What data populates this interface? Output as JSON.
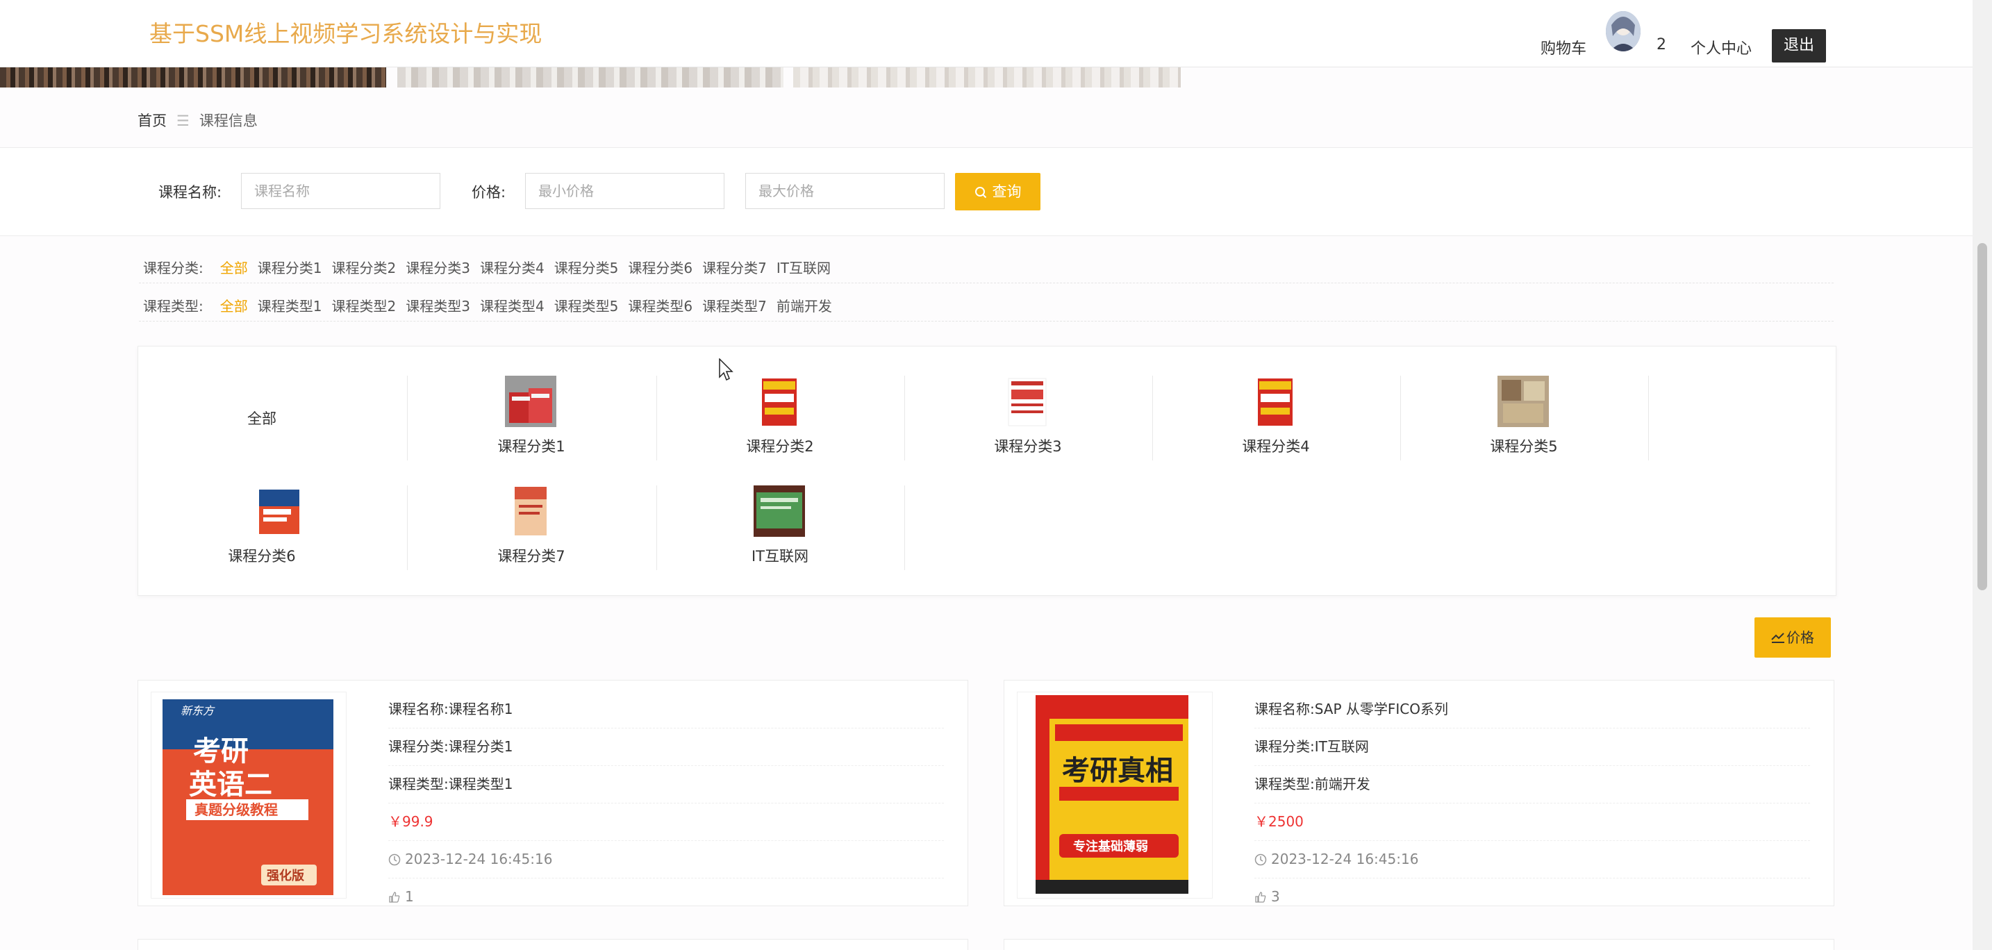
{
  "header": {
    "site_title": "基于SSM线上视频学习系统设计与实现",
    "cart_label": "购物车",
    "avatar_count": "2",
    "user_center_label": "个人中心",
    "logout_label": "退出"
  },
  "breadcrumb": {
    "home": "首页",
    "separator": "☰",
    "current": "课程信息"
  },
  "search": {
    "name_label": "课程名称:",
    "name_placeholder": "课程名称",
    "price_label": "价格:",
    "min_price_placeholder": "最小价格",
    "max_price_placeholder": "最大价格",
    "query_label": "查询"
  },
  "filters": {
    "category": {
      "label": "课程分类:",
      "options": [
        "全部",
        "课程分类1",
        "课程分类2",
        "课程分类3",
        "课程分类4",
        "课程分类5",
        "课程分类6",
        "课程分类7",
        "IT互联网"
      ],
      "active": "全部"
    },
    "type": {
      "label": "课程类型:",
      "options": [
        "全部",
        "课程类型1",
        "课程类型2",
        "课程类型3",
        "课程类型4",
        "课程类型5",
        "课程类型6",
        "课程类型7",
        "前端开发"
      ],
      "active": "全部"
    }
  },
  "category_panel": {
    "items": [
      {
        "name": "全部",
        "image": false
      },
      {
        "name": "课程分类1",
        "image": true
      },
      {
        "name": "课程分类2",
        "image": true
      },
      {
        "name": "课程分类3",
        "image": true
      },
      {
        "name": "课程分类4",
        "image": true
      },
      {
        "name": "课程分类5",
        "image": true
      },
      {
        "name": "课程分类6",
        "image": true
      },
      {
        "name": "课程分类7",
        "image": true
      },
      {
        "name": "IT互联网",
        "image": true
      }
    ]
  },
  "sort": {
    "price_label": "价格"
  },
  "courses": [
    {
      "name": "课程名称:课程名称1",
      "category": "课程分类:课程分类1",
      "type": "课程类型:课程类型1",
      "price": "￥99.9",
      "time": "2023-12-24 16:45:16",
      "likes": "1",
      "cover_title_1": "考研",
      "cover_title_2": "英语二",
      "cover_sub": "真题分级教程",
      "cover_badge": "强化版"
    },
    {
      "name": "课程名称:SAP 从零学FICO系列",
      "category": "课程分类:IT互联网",
      "type": "课程类型:前端开发",
      "price": "￥2500",
      "time": "2023-12-24 16:45:16",
      "likes": "3",
      "cover_title_1": "考研真相",
      "cover_sub": "专注基础薄弱"
    }
  ],
  "colors": {
    "accent": "#f5b50e",
    "title": "#e8a94b",
    "price": "#e33333",
    "logout_bg": "#2d2d2d"
  }
}
